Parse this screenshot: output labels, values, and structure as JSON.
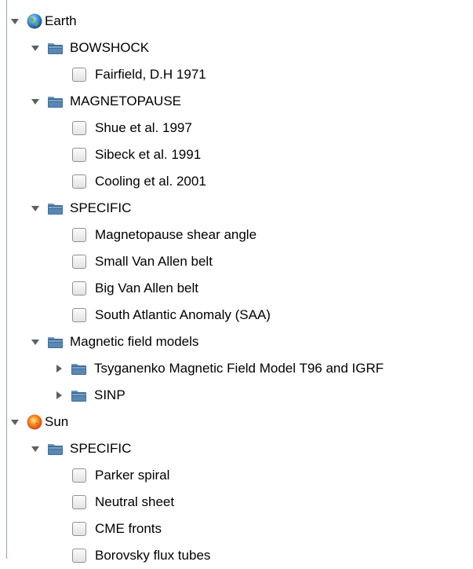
{
  "icons": {
    "earth": "earth-globe-icon",
    "sun": "sun-icon",
    "folder": "folder-icon",
    "expanded": "triangle-down-icon",
    "collapsed": "triangle-right-icon"
  },
  "colors": {
    "folder_body": "#3e6f9d",
    "folder_tab": "#6c97c3",
    "checkbox_border": "#8c9198",
    "tree_border": "#9aa3ad"
  },
  "tree": [
    {
      "label": "Earth",
      "type": "planet",
      "icon": "earth",
      "expanded": true,
      "children": [
        {
          "label": "BOWSHOCK",
          "type": "folder",
          "expanded": true,
          "children": [
            {
              "label": "Fairfield, D.H 1971",
              "type": "leaf",
              "checked": false
            }
          ]
        },
        {
          "label": "MAGNETOPAUSE",
          "type": "folder",
          "expanded": true,
          "children": [
            {
              "label": "Shue et al. 1997",
              "type": "leaf",
              "checked": false
            },
            {
              "label": "Sibeck et al. 1991",
              "type": "leaf",
              "checked": false
            },
            {
              "label": "Cooling et al. 2001",
              "type": "leaf",
              "checked": false
            }
          ]
        },
        {
          "label": "SPECIFIC",
          "type": "folder",
          "expanded": true,
          "children": [
            {
              "label": "Magnetopause shear angle",
              "type": "leaf",
              "checked": false
            },
            {
              "label": "Small Van Allen belt",
              "type": "leaf",
              "checked": false
            },
            {
              "label": "Big Van Allen belt",
              "type": "leaf",
              "checked": false
            },
            {
              "label": "South Atlantic Anomaly (SAA)",
              "type": "leaf",
              "checked": false
            }
          ]
        },
        {
          "label": "Magnetic field models",
          "type": "folder",
          "expanded": true,
          "children": [
            {
              "label": "Tsyganenko Magnetic Field Model T96 and IGRF",
              "type": "folder",
              "expanded": false,
              "children": []
            },
            {
              "label": "SINP",
              "type": "folder",
              "expanded": false,
              "children": []
            }
          ]
        }
      ]
    },
    {
      "label": "Sun",
      "type": "planet",
      "icon": "sun",
      "expanded": true,
      "children": [
        {
          "label": "SPECIFIC",
          "type": "folder",
          "expanded": true,
          "children": [
            {
              "label": "Parker spiral",
              "type": "leaf",
              "checked": false
            },
            {
              "label": "Neutral sheet",
              "type": "leaf",
              "checked": false
            },
            {
              "label": "CME fronts",
              "type": "leaf",
              "checked": false
            },
            {
              "label": "Borovsky flux tubes",
              "type": "leaf",
              "checked": false
            }
          ]
        }
      ]
    }
  ]
}
